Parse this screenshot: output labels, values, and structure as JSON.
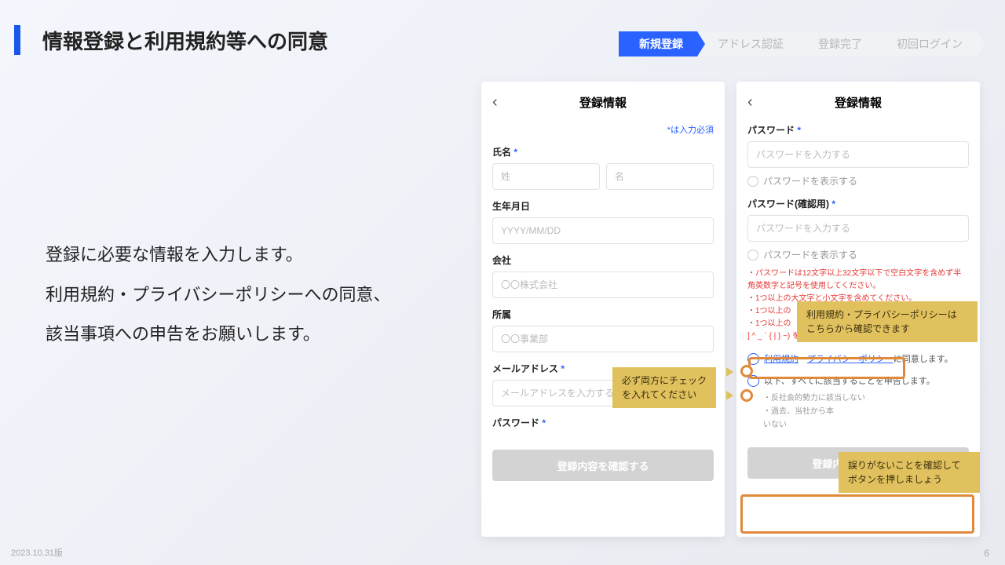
{
  "title": "情報登録と利用規約等への同意",
  "steps": [
    "新規登録",
    "アドレス認証",
    "登録完了",
    "初回ログイン"
  ],
  "body": {
    "l1": "登録に必要な情報を入力します。",
    "l2": "利用規約・プライバシーポリシーへの同意、",
    "l3": "該当事項への申告をお願いします。"
  },
  "phoneL": {
    "title": "登録情報",
    "req": "*は入力必須",
    "name": "氏名",
    "ast": " *",
    "ph_last": "姓",
    "ph_first": "名",
    "dob": "生年月日",
    "ph_dob": "YYYY/MM/DD",
    "company": "会社",
    "ph_company": "〇〇株式会社",
    "dept": "所属",
    "ph_dept": "〇〇事業部",
    "email": "メールアドレス",
    "ph_email": "メールアドレスを入力する",
    "pw": "パスワード",
    "confirm": "登録内容を確認する"
  },
  "phoneR": {
    "title": "登録情報",
    "pw": "パスワード",
    "ast": " *",
    "ph_pw": "パスワードを入力する",
    "show": "パスワードを表示する",
    "pw2": "パスワード(確認用)",
    "rule1": "・パスワードは12文字以上32文字以下で空白文字を含めず半角英数字と記号を使用してください。",
    "rule2": "・1つ以上の大文字と小文字を含めてください。",
    "rule3": "・1つ以上の",
    "rule4": "・1つ以上の",
    "rule5": "] ^ _ ` { | } ~) を含めてください。",
    "terms": "利用規約",
    "dot": "・",
    "privacy": "プライバシーポリシー",
    "agree": "に同意します。",
    "declare": "以下、すべてに該当することを申告します。",
    "d1": "・反社会的勢力に該当しない",
    "d2": "・過去、当社から本",
    "d2b": "いない",
    "confirm": "登録内容を確認する"
  },
  "callouts": {
    "c1a": "必ず両方にチェック",
    "c1b": "を入れてください",
    "c2a": "利用規約・プライバシーポリシーは",
    "c2b": "こちらから確認できます",
    "c3a": "誤りがないことを確認して",
    "c3b": "ボタンを押しましょう"
  },
  "footer": "2023.10.31版",
  "page": "6"
}
